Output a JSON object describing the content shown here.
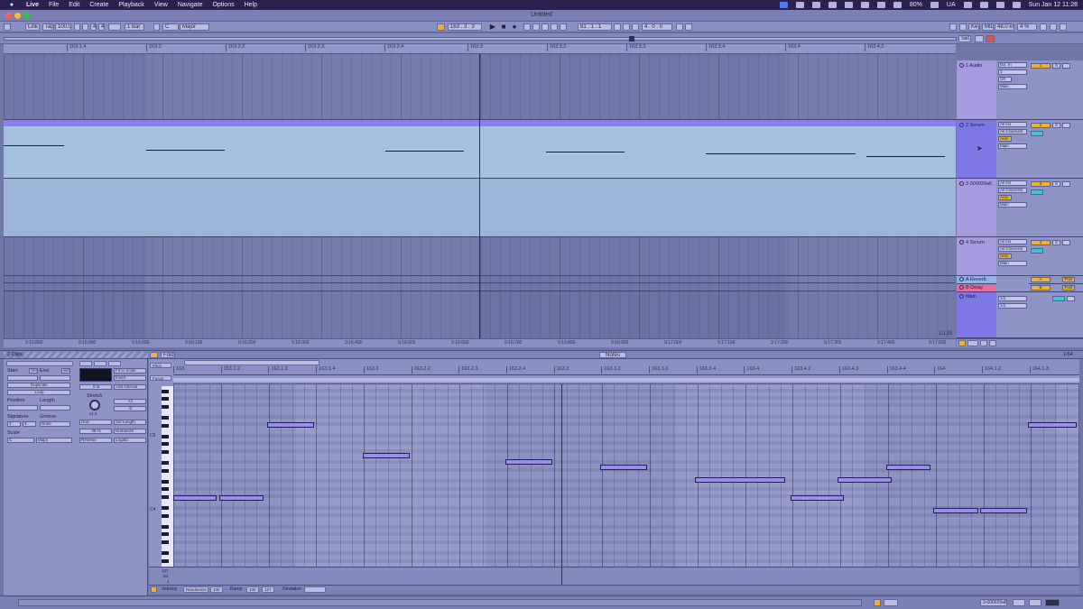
{
  "menubar": {
    "app_name": "Live",
    "items": [
      "File",
      "Edit",
      "Create",
      "Playback",
      "View",
      "Navigate",
      "Options",
      "Help"
    ],
    "right": {
      "battery": "80%",
      "input_source": "UA",
      "clock": "Sun Jan 12  11:28"
    }
  },
  "window": {
    "title": "Untitled"
  },
  "transport": {
    "link": "Link",
    "tap": "Tap",
    "tempo": "100.00",
    "sig_num": "4",
    "sig_den": "4",
    "quantize": "1 Bar",
    "key": "C",
    "scale": "Major",
    "position": "163 . 3 . 3",
    "loop_start": "81 . 1 . 1",
    "loop_len": "4 . 0 . 0",
    "key_label": "Key",
    "midi_label": "MIDI",
    "sample_rate": "48.0 kHz",
    "cpu": "4 %"
  },
  "arrangement": {
    "ruler_ticks": [
      "163.1.4",
      "163.2",
      "163.2.2",
      "163.2.3",
      "163.2.4",
      "163.3",
      "163.3.2",
      "163.3.3",
      "163.3.4",
      "163.4",
      "163.4.2",
      "163.4.3"
    ],
    "time_ticks": [
      "9:15:800",
      "9:15:900",
      "9:16:000",
      "9:16:100",
      "9:16:200",
      "9:16:300",
      "9:16:400",
      "9:16:500",
      "9:16:600",
      "9:16:700",
      "9:16:800",
      "9:16:900",
      "9:17:000",
      "9:17:100",
      "9:17:200",
      "9:17:300",
      "9:17:400",
      "9:17:500"
    ],
    "zoom_label": "1/128",
    "tracks": [
      {
        "name": "1 Audio",
        "io_top": "Ext. In",
        "io_mid": "1",
        "monitor": "Off",
        "out": "Main",
        "num": "1",
        "sends": "S"
      },
      {
        "name": "2 Serum",
        "io_top": "All Ins",
        "io_mid": "All Channels",
        "monitor": "Auto",
        "out": "Main",
        "num": "2",
        "sends": "S"
      },
      {
        "name": "3 000029a6",
        "io_top": "All Ins",
        "io_mid": "All Channels",
        "monitor": "Auto",
        "out": "Main",
        "num": "3",
        "sends": "S"
      },
      {
        "name": "4 Serum",
        "io_top": "All Ins",
        "io_mid": "All Channels",
        "monitor": "Auto",
        "out": "Main",
        "num": "4",
        "sends": "S"
      },
      {
        "name": "A Reverb",
        "num": "A",
        "post": "Post"
      },
      {
        "name": "B Delay",
        "num": "B",
        "post": "Post"
      },
      {
        "name": "Main",
        "out_a": "1/2",
        "out_b": "1/2"
      }
    ],
    "session_btns": [
      "Set",
      "Key",
      "MIDI"
    ]
  },
  "detail": {
    "header": {
      "clips_label": "2 Clips",
      "fold": "Fold",
      "notes_tab": "Notes",
      "grid_label": "1/64",
      "pitch": "Pitch",
      "focus": "Focus"
    },
    "clip_panel": {
      "start": "Start",
      "end": "End",
      "set1": "Set",
      "set2": "Set",
      "duplicate": "Duplicate",
      "loop": "Loop",
      "position": "Position",
      "length": "Length",
      "signature": "Signature",
      "groove": "Groove",
      "sig_num": "4",
      "sig_den": "4",
      "groove_val": "None",
      "scale": "Scale",
      "scale_root": "C",
      "scale_name": "Major",
      "fit_to_scale": "Fit to Scale",
      "invert": "Invert",
      "add_interval": "Add Interval",
      "semitones": "0 st",
      "stretch": "Stretch",
      "stretch_val": "x1.0",
      "x2": "×2",
      "half": "/2",
      "grid": "Grid",
      "set_length": "Set Length",
      "humanize": "Humanize",
      "legato": "Legato",
      "reverse": "Reverse",
      "humanize_pct": "35 %"
    },
    "roll_ticks": [
      "163",
      "163.1.2",
      "163.1.3",
      "163.1.4",
      "163.2",
      "163.2.2",
      "163.2.3",
      "163.2.4",
      "163.3",
      "163.3.2",
      "163.3.3",
      "163.3.4",
      "163.4",
      "163.4.2",
      "163.4.3",
      "163.4.4",
      "164",
      "164.1.2",
      "164.1.3"
    ],
    "octave_labels": [
      "C5",
      "C4"
    ],
    "velocity_labels": [
      "127",
      "64",
      "1"
    ],
    "footer": {
      "velocity": "Velocity",
      "randomize": "Randomize",
      "vel_val": "100",
      "ramp": "Ramp",
      "ramp_a": "100",
      "ramp_b": "127",
      "deviation": "Deviation"
    }
  },
  "status": {
    "track_name": "3-000029a6"
  },
  "colors": {
    "accent": "#f0b429",
    "clip": "#a6c0e0",
    "note": "#9b8cf0",
    "track_header": "#a79be0",
    "selected_track": "#7e78e6"
  }
}
